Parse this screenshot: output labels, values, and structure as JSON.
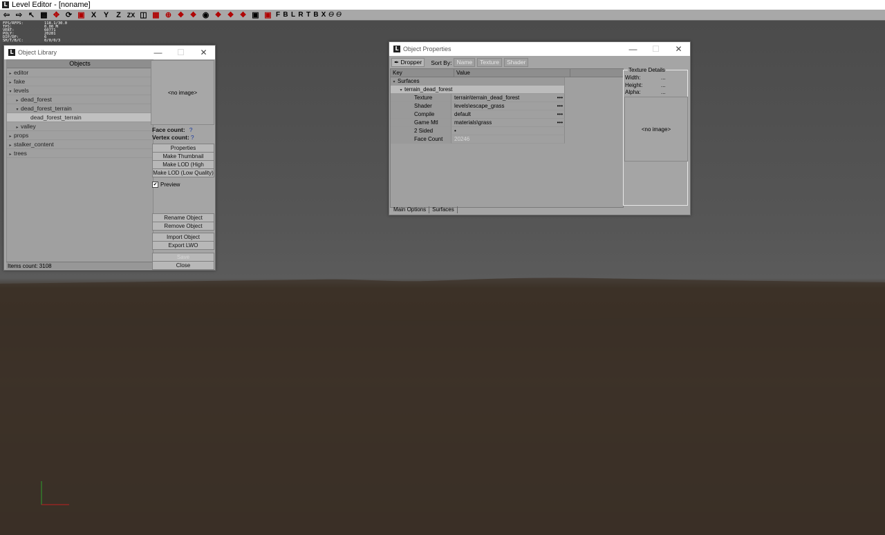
{
  "app": {
    "title": "Level Editor - [noname]",
    "icon": "L"
  },
  "toolbar": {
    "icons": [
      "undo-icon",
      "redo-icon",
      "select-icon",
      "camera-icon",
      "move-icon",
      "rotate-icon",
      "scale-icon",
      "lock-x-icon",
      "lock-y-icon",
      "lock-z-icon",
      "lock-zx-icon",
      "snap-grid-icon",
      "snap-object-icon",
      "snap-vertex-icon",
      "magnet-icon",
      "snap-rotate-icon",
      "snap-scale-icon",
      "snap-move-icon",
      "snap-angle-icon",
      "camera-snap-icon",
      "zoom-extents-icon"
    ],
    "axis_labels": [
      "X",
      "Y",
      "Z",
      "ZX"
    ],
    "view_labels": [
      "F",
      "B",
      "L",
      "R",
      "T",
      "B",
      "X"
    ],
    "extra_labels": [
      "Ɵ",
      "Ɵ"
    ]
  },
  "stats": [
    {
      "k": "FPS/RFPS:",
      "v": "118.1/30.0"
    },
    {
      "k": "TPS:",
      "v": "0.00 M"
    },
    {
      "k": "VERT:",
      "v": "60771"
    },
    {
      "k": "POLY:",
      "v": "20281"
    },
    {
      "k": "DIP/DP:",
      "v": "6"
    },
    {
      "k": "SH/T/B/C:",
      "v": "0/0/0/3"
    }
  ],
  "object_library": {
    "title": "Object Library",
    "header": "Objects",
    "tree": [
      {
        "label": "editor",
        "level": 0,
        "arrow": "▸"
      },
      {
        "label": "fake",
        "level": 0,
        "arrow": "▸"
      },
      {
        "label": "levels",
        "level": 0,
        "arrow": "▾"
      },
      {
        "label": "dead_forest",
        "level": 1,
        "arrow": "▸"
      },
      {
        "label": "dead_forest_terrain",
        "level": 1,
        "arrow": "▾"
      },
      {
        "label": "dead_forest_terrain",
        "level": 2,
        "arrow": ""
      },
      {
        "label": "valley",
        "level": 1,
        "arrow": "▸"
      },
      {
        "label": "props",
        "level": 0,
        "arrow": "▸"
      },
      {
        "label": "stalker_content",
        "level": 0,
        "arrow": "▸"
      },
      {
        "label": "trees",
        "level": 0,
        "arrow": "▸"
      }
    ],
    "no_image": "<no image>",
    "face_count_label": "Face count:",
    "face_count_value": "?",
    "vertex_count_label": "Vertex count:",
    "vertex_count_value": "?",
    "buttons": {
      "properties": "Properties",
      "make_thumbnail": "Make Thumbnail",
      "make_lod_high": "Make LOD (High Quality)",
      "make_lod_low": "Make LOD (Low Quality)",
      "rename": "Rename Object",
      "remove": "Remove Object",
      "import": "Import Object",
      "export_lwo": "Export LWO",
      "save": "Save",
      "close": "Close"
    },
    "preview_label": "Preview",
    "preview_checked": "✔",
    "items_count": "Items count: 3108"
  },
  "object_properties": {
    "title": "Object Properties",
    "dropper": "Dropper",
    "sort_by": "Sort By:",
    "sort_tabs": [
      "Name",
      "Texture",
      "Shader"
    ],
    "col_key": "Key",
    "col_value": "Value",
    "group": "Surfaces",
    "subgroup": "terrain_dead_forest",
    "rows": [
      {
        "key": "Texture",
        "value": "terrain\\terrain_dead_forest",
        "dots": "•••"
      },
      {
        "key": "Shader",
        "value": "levels\\escape_grass",
        "dots": "•••"
      },
      {
        "key": "Compile",
        "value": "default",
        "dots": "•••"
      },
      {
        "key": "Game Mtl",
        "value": "materials\\grass",
        "dots": "•••"
      },
      {
        "key": "2 Sided",
        "value": "•",
        "dots": ""
      },
      {
        "key": "Face Count",
        "value": "20246",
        "dots": ""
      }
    ],
    "texture_details": {
      "title": "Texture Details",
      "width_label": "Width:",
      "width_value": "...",
      "height_label": "Height:",
      "height_value": "...",
      "alpha_label": "Alpha:",
      "alpha_value": "...",
      "no_image": "<no image>"
    },
    "tabs": [
      "Main Options",
      "Surfaces"
    ]
  }
}
